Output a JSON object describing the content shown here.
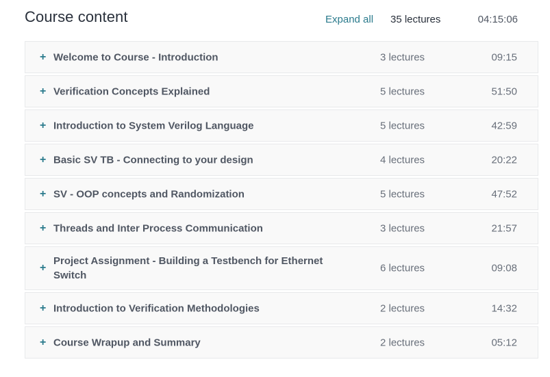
{
  "header": {
    "title": "Course content",
    "expand_all_label": "Expand all",
    "total_lectures": "35 lectures",
    "total_duration": "04:15:06"
  },
  "sections": [
    {
      "icon": "plus-icon",
      "title": "Welcome to Course - Introduction",
      "lectures": "3 lectures",
      "duration": "09:15"
    },
    {
      "icon": "plus-icon",
      "title": "Verification Concepts Explained",
      "lectures": "5 lectures",
      "duration": "51:50"
    },
    {
      "icon": "plus-icon",
      "title": "Introduction to System Verilog Language",
      "lectures": "5 lectures",
      "duration": "42:59"
    },
    {
      "icon": "plus-icon",
      "title": "Basic SV TB - Connecting to your design",
      "lectures": "4 lectures",
      "duration": "20:22"
    },
    {
      "icon": "plus-icon",
      "title": "SV - OOP concepts and Randomization",
      "lectures": "5 lectures",
      "duration": "47:52"
    },
    {
      "icon": "plus-icon",
      "title": "Threads and Inter Process Communication",
      "lectures": "3 lectures",
      "duration": "21:57"
    },
    {
      "icon": "plus-icon",
      "title": "Project Assignment - Building a Testbench for Ethernet Switch",
      "lectures": "6 lectures",
      "duration": "09:08"
    },
    {
      "icon": "plus-icon",
      "title": "Introduction to Verification Methodologies",
      "lectures": "2 lectures",
      "duration": "14:32"
    },
    {
      "icon": "plus-icon",
      "title": "Course Wrapup and Summary",
      "lectures": "2 lectures",
      "duration": "05:12"
    }
  ],
  "colors": {
    "accent": "#2a7a8c",
    "row_background": "#f9f9f9",
    "row_border": "#e8e9eb",
    "title_text": "#29303b",
    "muted_text": "#686f7a"
  }
}
